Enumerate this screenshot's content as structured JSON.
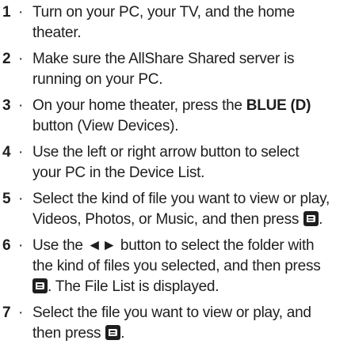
{
  "steps": [
    {
      "num": "1",
      "bullet": "·",
      "l1": "Turn on your PC, your TV, and the home",
      "l2": "theater."
    },
    {
      "num": "2",
      "bullet": "·",
      "l1": "Make sure the AllShare Shared server is",
      "l2": "running on your PC."
    },
    {
      "num": "3",
      "bullet": "·",
      "l1a": "On your home theater, press the ",
      "l1b": "BLUE (D)",
      "l2": "button (View Devices)."
    },
    {
      "num": "4",
      "bullet": "·",
      "l1": "Use the left or right arrow button to select",
      "l2": "your PC in the Device List."
    },
    {
      "num": "5",
      "bullet": "·",
      "l1": "Select the kind of file you want to view or play,",
      "l2a": "Videos, Photos, or Music, and then press ",
      "l2b": "."
    },
    {
      "num": "6",
      "bullet": "·",
      "l1": "Use the ◄► button to select the folder with",
      "l2": "the kind of files you selected, and then press",
      "l3b": ". The File List is displayed."
    },
    {
      "num": "7",
      "bullet": "·",
      "l1": "Select the file you want to view or play, and",
      "l2a": "then press ",
      "l2b": "."
    }
  ],
  "icons": {
    "enter": "enter-button-icon"
  }
}
